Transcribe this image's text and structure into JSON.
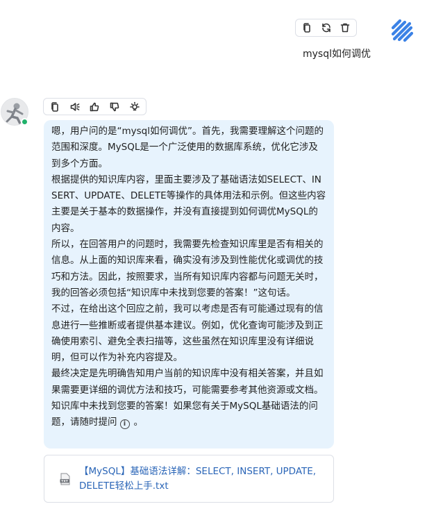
{
  "user_message": {
    "text": "mysql如何调优"
  },
  "user_toolbar": {
    "icons": [
      "copy-icon",
      "refresh-icon",
      "trash-icon"
    ]
  },
  "assistant_toolbar": {
    "icons": [
      "copy-icon",
      "speaker-icon",
      "thumbs-up-icon",
      "thumbs-down-icon",
      "lightbulb-icon"
    ]
  },
  "assistant_message": {
    "paragraphs": [
      "嗯，用户问的是“mysql如何调优”。首先，我需要理解这个问题的范围和深度。MySQL是一个广泛使用的数据库系统，优化它涉及到多个方面。",
      "根据提供的知识库内容，里面主要涉及了基础语法如SELECT、INSERT、UPDATE、DELETE等操作的具体用法和示例。但这些内容主要是关于基本的数据操作，并没有直接提到如何调优MySQL的内容。",
      "所以，在回答用户的问题时，我需要先检查知识库里是否有相关的信息。从上面的知识库来看，确实没有涉及到性能优化或调优的技巧和方法。因此，按照要求，当所有知识库内容都与问题无关时，我的回答必须包括“知识库中未找到您要的答案！”这句话。",
      "不过，在给出这个回应之前，我可以考虑是否有可能通过现有的信息进行一些推断或者提供基本建议。例如，优化查询可能涉及到正确使用索引、避免全表扫描等，这些虽然在知识库里没有详细说明，但可以作为补充内容提及。",
      "最终决定是先明确告知用户当前的知识库中没有相关答案，并且如果需要更详细的调优方法和技巧，可能需要参考其他资源或文档。"
    ],
    "final_text": "知识库中未找到您要的答案！如果您有关于MySQL基础语法的问题，请随时提问",
    "final_suffix": "。",
    "info_glyph": "i"
  },
  "reference": {
    "file_label": "【MySQL】基础语法详解：SELECT, INSERT, UPDATE, DELETE轻松上手.txt",
    "file_icon_text": "TXT"
  },
  "colors": {
    "bubble_bg": "#e7f3fd",
    "link": "#2a65b7",
    "online": "#20b26b",
    "brand": "#3b82e6"
  }
}
